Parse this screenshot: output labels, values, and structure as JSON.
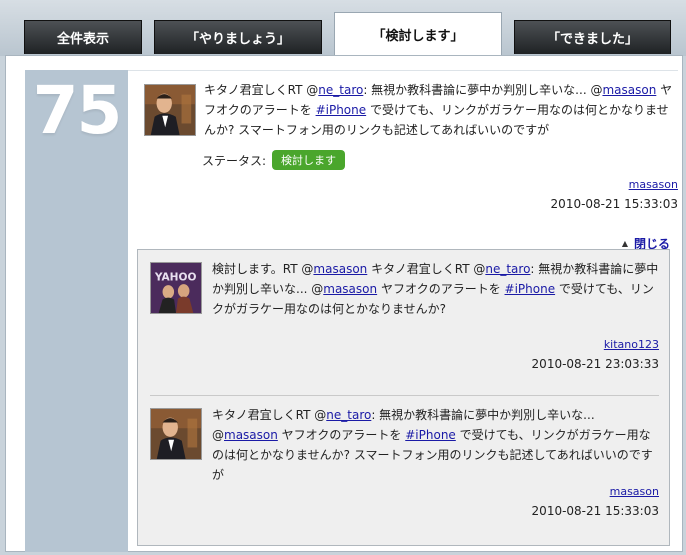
{
  "tabs": [
    {
      "label": "全件表示",
      "active": false
    },
    {
      "label": "「やりましょう」",
      "active": false
    },
    {
      "label": "「検討します」",
      "active": true
    },
    {
      "label": "「できました」",
      "active": false
    }
  ],
  "item_number": "75",
  "main_tweet": {
    "prefix": "キタノ君宜しくRT @",
    "mention1": "ne_taro",
    "mid1": ": 無視か教科書論に夢中か判別し辛いな... @",
    "mention2": "masason",
    "mid2": " ヤフオクのアラートを ",
    "hashtag": "#iPhone",
    "suffix": " で受けても、リンクがガラケー用なのは何とかなりませんか? スマートフォン用のリンクも記述してあればいいのですが",
    "status_label": "ステータス:",
    "status_value": "検討します",
    "author": "masason",
    "time": "2010-08-21 15:33:03",
    "close_label": "閉じる"
  },
  "replies": [
    {
      "prefix": "検討します。RT @",
      "mention1": "masason",
      "mid1": " キタノ君宜しくRT @",
      "mention2": "ne_taro",
      "mid2": ": 無視か教科書論に夢中か判別し辛いな... @",
      "mention3": "masason",
      "mid3": " ヤフオクのアラートを ",
      "hashtag": "#iPhone",
      "suffix": " で受けても、リンクがガラケー用なのは何とかなりませんか?",
      "author": "kitano123",
      "time": "2010-08-21 23:03:33"
    },
    {
      "prefix": "キタノ君宜しくRT @",
      "mention1": "ne_taro",
      "mid1": ": 無視か教科書論に夢中か判別し辛いな... @",
      "mention2": "masason",
      "mid2": " ヤフオクのアラートを ",
      "hashtag": "#iPhone",
      "suffix": " で受けても、リンクがガラケー用なのは何とかなりませんか? スマートフォン用のリンクも記述してあればいいのですが",
      "author": "masason",
      "time": "2010-08-21 15:33:03"
    }
  ],
  "colors": {
    "accent_green": "#4aa62c",
    "number_col": "#b6c5d2",
    "link": "#1a1aa6"
  }
}
